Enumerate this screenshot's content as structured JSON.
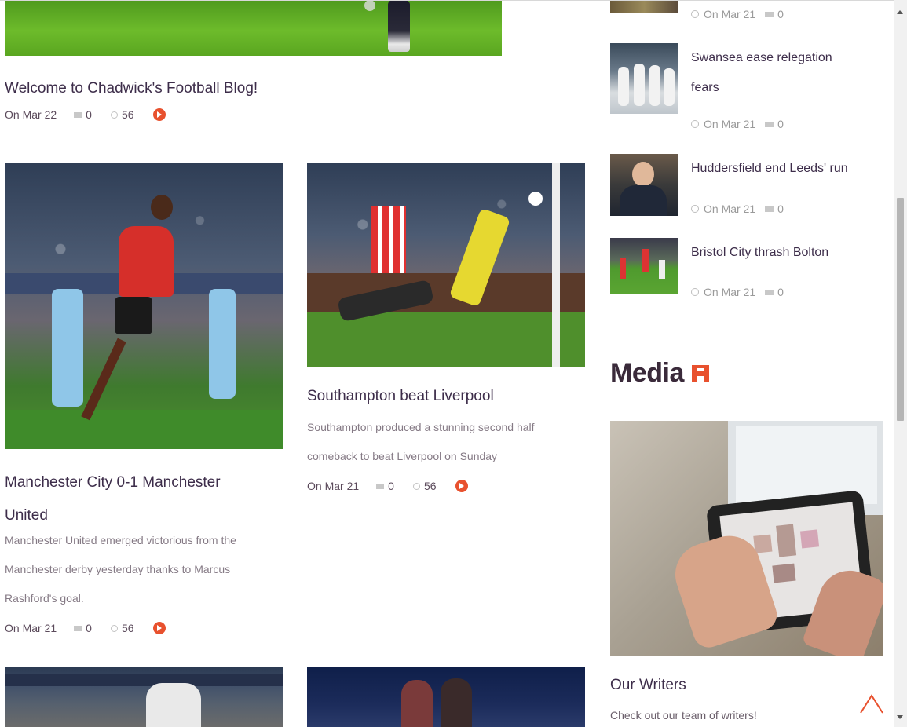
{
  "posts": {
    "welcome": {
      "title": "Welcome to Chadwick's Football Blog!",
      "date": "On Mar 22",
      "comments": "0",
      "views": "56"
    },
    "man_city": {
      "title": "Manchester City 0-1 Manchester United",
      "excerpt": "Manchester United emerged victorious from the Manchester derby yesterday thanks to Marcus Rashford's goal.",
      "date": "On Mar 21",
      "comments": "0",
      "views": "56"
    },
    "southampton": {
      "title": "Southampton beat Liverpool",
      "excerpt": "Southampton produced a stunning second half comeback to beat Liverpool on Sunday",
      "date": "On Mar 21",
      "comments": "0",
      "views": "56"
    }
  },
  "sidebar": {
    "recent": [
      {
        "title": "",
        "date": "On Mar 21",
        "comments": "0"
      },
      {
        "title": "Swansea ease relegation fears",
        "date": "On Mar 21",
        "comments": "0"
      },
      {
        "title": "Huddersfield end Leeds' run",
        "date": "On Mar 21",
        "comments": "0"
      },
      {
        "title": "Bristol City thrash Bolton",
        "date": "On Mar 21",
        "comments": "0"
      }
    ],
    "media_heading": "Media",
    "writers_title": "Our Writers",
    "writers_text": "Check out our team of writers!"
  },
  "colors": {
    "accent": "#e8512e",
    "title": "#3d2d4a"
  },
  "icons": {
    "comment": "comment-icon",
    "views": "eye-icon",
    "more": "arrow-circle-icon",
    "clock": "clock-icon",
    "back_to_top": "chevron-up-icon"
  }
}
